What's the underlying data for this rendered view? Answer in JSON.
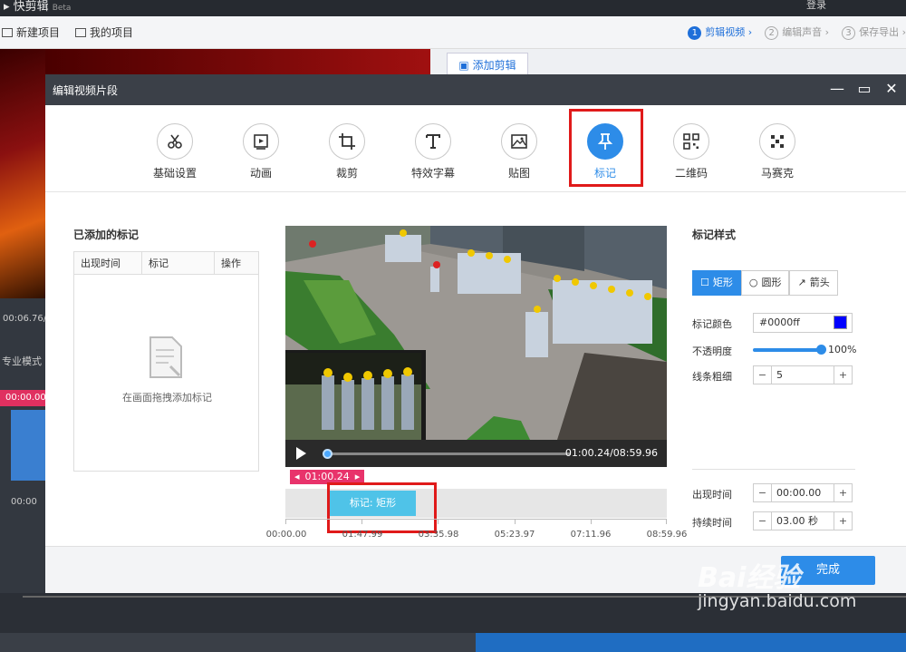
{
  "app": {
    "title": "快剪辑",
    "beta": "Beta",
    "login": "登录",
    "toolbar": {
      "new_project": "新建项目",
      "my_projects": "我的项目"
    },
    "steps": [
      {
        "num": "1",
        "label": "剪辑视频"
      },
      {
        "num": "2",
        "label": "编辑声音"
      },
      {
        "num": "3",
        "label": "保存导出"
      }
    ],
    "add_clip_tab": "添加剪辑",
    "bg_time": "00:06.76/",
    "bg_mode": "专业模式",
    "bg_pink_time": "00:00.00",
    "bg_time2": "00:00"
  },
  "dialog": {
    "title": "编辑视频片段",
    "tools": [
      {
        "label": "基础设置",
        "icon": "scissors-icon"
      },
      {
        "label": "动画",
        "icon": "animation-icon"
      },
      {
        "label": "裁剪",
        "icon": "crop-icon"
      },
      {
        "label": "特效字幕",
        "icon": "text-icon"
      },
      {
        "label": "贴图",
        "icon": "image-icon"
      },
      {
        "label": "标记",
        "icon": "pin-icon"
      },
      {
        "label": "二维码",
        "icon": "qrcode-icon"
      },
      {
        "label": "马赛克",
        "icon": "mosaic-icon"
      }
    ],
    "active_tool": "标记",
    "added_marks": {
      "title": "已添加的标记",
      "columns": [
        "出现时间",
        "标记",
        "操作"
      ],
      "empty_text": "在画面拖拽添加标记"
    },
    "player": {
      "time": "01:00.24/08:59.96"
    },
    "timeline": {
      "current": "01:00.24",
      "mark_label": "标记: 矩形",
      "ticks": [
        "00:00.00",
        "01:47.99",
        "03:35.98",
        "05:23.97",
        "07:11.96",
        "08:59.96"
      ]
    },
    "style_panel": {
      "title": "标记样式",
      "shapes": [
        "矩形",
        "圆形",
        "箭头"
      ],
      "color_label": "标记颜色",
      "color_value": "#0000ff",
      "color": "#0000ff",
      "opacity_label": "不透明度",
      "opacity_value": "100%",
      "opacity": 1.0,
      "line_label": "线条粗细",
      "line_value": "5",
      "appear_label": "出现时间",
      "appear_value": "00:00.00",
      "duration_label": "持续时间",
      "duration_value": "03.00 秒"
    },
    "done_label": "完成"
  },
  "watermark": {
    "brand": "Bai经验",
    "url": "jingyan.baidu.com"
  }
}
